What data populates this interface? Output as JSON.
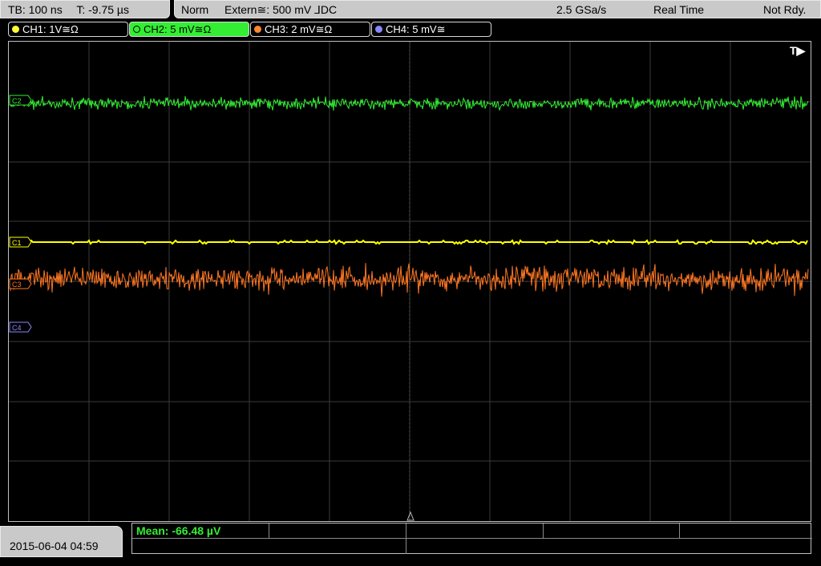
{
  "topbar": {
    "timebase": "TB: 100 ns",
    "trigger_time": "T: -9.75 µs",
    "mode": "Norm",
    "trigger_source": "Extern≅: 500 mV ⅃DC",
    "sample_rate": "2.5 GSa/s",
    "acq_mode": "Real Time",
    "status": "Not Rdy."
  },
  "channels": [
    {
      "label": "CH1: 1V≅Ω",
      "color": "#ffff33",
      "active": false
    },
    {
      "label": "CH2: 5 mV≅Ω",
      "color": "#33ee33",
      "active": true
    },
    {
      "label": "CH3: 2 mV≅Ω",
      "color": "#ff8833",
      "active": false
    },
    {
      "label": "CH4: 5 mV≅",
      "color": "#8888ff",
      "active": false
    }
  ],
  "screen": {
    "trigger_marker": "T▶",
    "markers": {
      "c1": "C1",
      "c2": "C2",
      "c3": "C3",
      "c4": "C4"
    }
  },
  "traces": {
    "ch1_color": "#ffff00",
    "ch2_color": "#33ee33",
    "ch3_color": "#ff7722",
    "ch4_color": "#8888ff"
  },
  "footer": {
    "datetime": "2015-06-04 04:59",
    "measurement": "Mean: -66.48 µV"
  }
}
